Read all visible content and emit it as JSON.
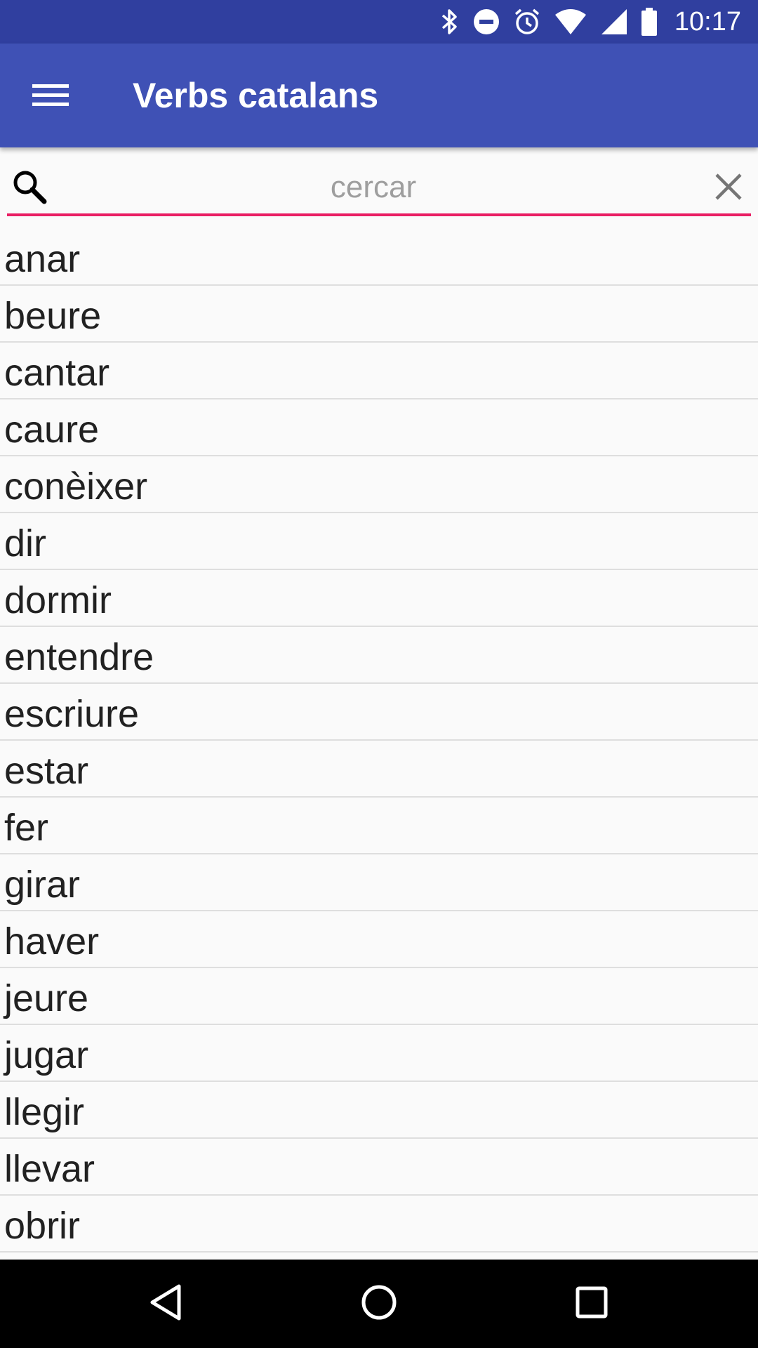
{
  "status_bar": {
    "time": "10:17",
    "icons": [
      "bluetooth-icon",
      "do-not-disturb-icon",
      "alarm-icon",
      "wifi-icon",
      "cell-signal-icon",
      "battery-icon"
    ]
  },
  "app_bar": {
    "title": "Verbs catalans",
    "menu_icon": "menu-icon"
  },
  "search": {
    "placeholder": "cercar",
    "value": "",
    "search_icon": "search-icon",
    "clear_icon": "close-icon"
  },
  "verbs": [
    "anar",
    "beure",
    "cantar",
    "caure",
    "conèixer",
    "dir",
    "dormir",
    "entendre",
    "escriure",
    "estar",
    "fer",
    "girar",
    "haver",
    "jeure",
    "jugar",
    "llegir",
    "llevar",
    "obrir"
  ],
  "nav_bar": {
    "buttons": [
      "back-icon",
      "home-icon",
      "recents-icon"
    ]
  },
  "colors": {
    "status_bar": "#303f9f",
    "app_bar": "#3f51b5",
    "accent": "#e91e63",
    "background": "#fafafa"
  }
}
